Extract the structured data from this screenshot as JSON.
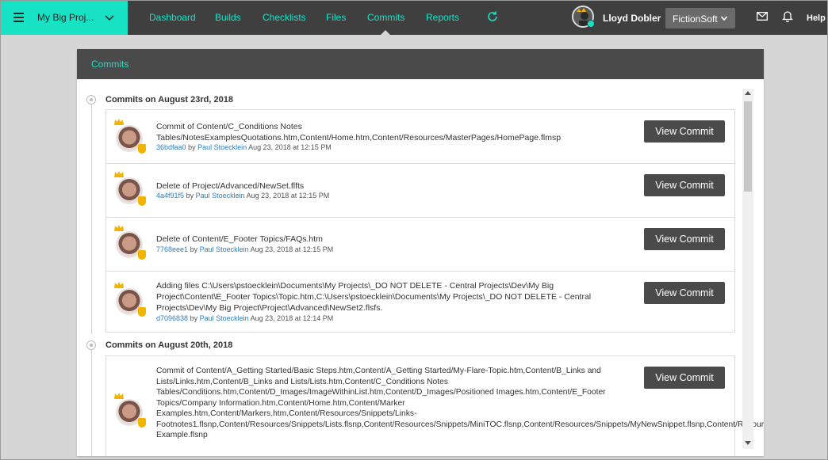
{
  "topbar": {
    "project_name": "My Big Proj...",
    "nav": [
      "Dashboard",
      "Builds",
      "Checklists",
      "Files",
      "Commits",
      "Reports"
    ],
    "active_nav": "Commits",
    "user_name": "Lloyd Dobler",
    "company": "FictionSoft",
    "help": "Help"
  },
  "panel": {
    "title": "Commits"
  },
  "groups": [
    {
      "title": "Commits on August 23rd, 2018",
      "commits": [
        {
          "message": "Commit of Content/C_Conditions Notes Tables/NotesExamplesQuotations.htm,Content/Home.htm,Content/Resources/MasterPages/HomePage.flmsp",
          "hash": "36bdfaa0",
          "by": "by",
          "author": "Paul Stoecklein",
          "date": "Aug 23, 2018 at 12:15 PM",
          "button": "View Commit"
        },
        {
          "message": "Delete of Project/Advanced/NewSet.flfts",
          "hash": "4a4f91f5",
          "by": "by",
          "author": "Paul Stoecklein",
          "date": "Aug 23, 2018 at 12:15 PM",
          "button": "View Commit"
        },
        {
          "message": "Delete of Content/E_Footer Topics/FAQs.htm",
          "hash": "7768eee1",
          "by": "by",
          "author": "Paul Stoecklein",
          "date": "Aug 23, 2018 at 12:15 PM",
          "button": "View Commit"
        },
        {
          "message": "Adding files C:\\Users\\pstoecklein\\Documents\\My Projects\\_DO NOT DELETE - Central Projects\\Dev\\My Big Project\\Content\\E_Footer Topics\\Topic.htm,C:\\Users\\pstoecklein\\Documents\\My Projects\\_DO NOT DELETE - Central Projects\\Dev\\My Big Project\\Project\\Advanced\\NewSet2.flsfs.",
          "hash": "d7096838",
          "by": "by",
          "author": "Paul Stoecklein",
          "date": "Aug 23, 2018 at 12:14 PM",
          "button": "View Commit"
        }
      ]
    },
    {
      "title": "Commits on August 20th, 2018",
      "commits": [
        {
          "message": "Commit of Content/A_Getting Started/Basic Steps.htm,Content/A_Getting Started/My-Flare-Topic.htm,Content/B_Links and Lists/Links.htm,Content/B_Links and Lists/Lists.htm,Content/C_Conditions Notes Tables/Conditions.htm,Content/D_Images/ImageWithinList.htm,Content/D_Images/Positioned Images.htm,Content/E_Footer Topics/Company Information.htm,Content/Home.htm,Content/Marker Examples.htm,Content/Markers.htm,Content/Resources/Snippets/Links-Footnotes1.flsnp,Content/Resources/Snippets/Lists.flsnp,Content/Resources/Snippets/MiniTOC.flsnp,Content/Resources/Snippets/MyNewSnippet.flsnp,Content/Resources/Snippets/MySnippet.flsnp,Content/Resources/Snippets/Snippet-Example.flsnp",
          "button": "View Commit"
        }
      ]
    }
  ],
  "colors": {
    "accent": "#17e2c4",
    "topbar": "#3f3f3f",
    "button": "#4a4a4a",
    "link": "#2f7fbf",
    "badge": "#f2b400"
  }
}
